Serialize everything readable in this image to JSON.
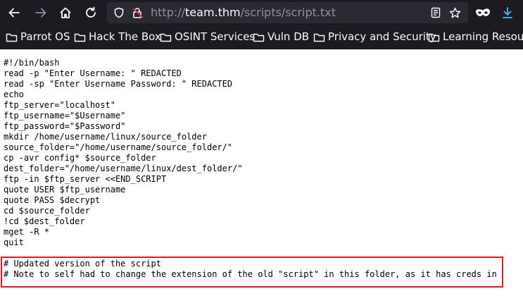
{
  "browser": {
    "url_scheme": "http://",
    "url_host": "team.thm",
    "url_path": "/scripts/script.txt"
  },
  "bookmarks": [
    {
      "label": "Parrot OS"
    },
    {
      "label": "Hack The Box"
    },
    {
      "label": "OSINT Services"
    },
    {
      "label": "Vuln DB"
    },
    {
      "label": "Privacy and Security"
    },
    {
      "label": "Learning Resources"
    }
  ],
  "file": {
    "lines": [
      "#!/bin/bash",
      "read -p \"Enter Username: \" REDACTED",
      "read -sp \"Enter Username Password: \" REDACTED",
      "echo",
      "ftp_server=\"localhost\"",
      "ftp_username=\"$Username\"",
      "ftp_password=\"$Password\"",
      "mkdir /home/username/linux/source_folder",
      "source_folder=\"/home/username/source_folder/\"",
      "cp -avr config* $source_folder",
      "dest_folder=\"/home/username/linux/dest_folder/\"",
      "ftp -in $ftp_server <<END_SCRIPT",
      "quote USER $ftp_username",
      "quote PASS $decrypt",
      "cd $source_folder",
      "!cd $dest_folder",
      "mget -R *",
      "quit",
      "",
      "# Updated version of the script",
      "# Note to self had to change the extension of the old \"script\" in this folder, as it has creds in"
    ]
  },
  "colors": {
    "chrome_bg": "#1c1b22",
    "urlbar_bg": "#2b2a33",
    "highlight_border": "#d91c1c",
    "download_icon": "#3fc1ff"
  }
}
